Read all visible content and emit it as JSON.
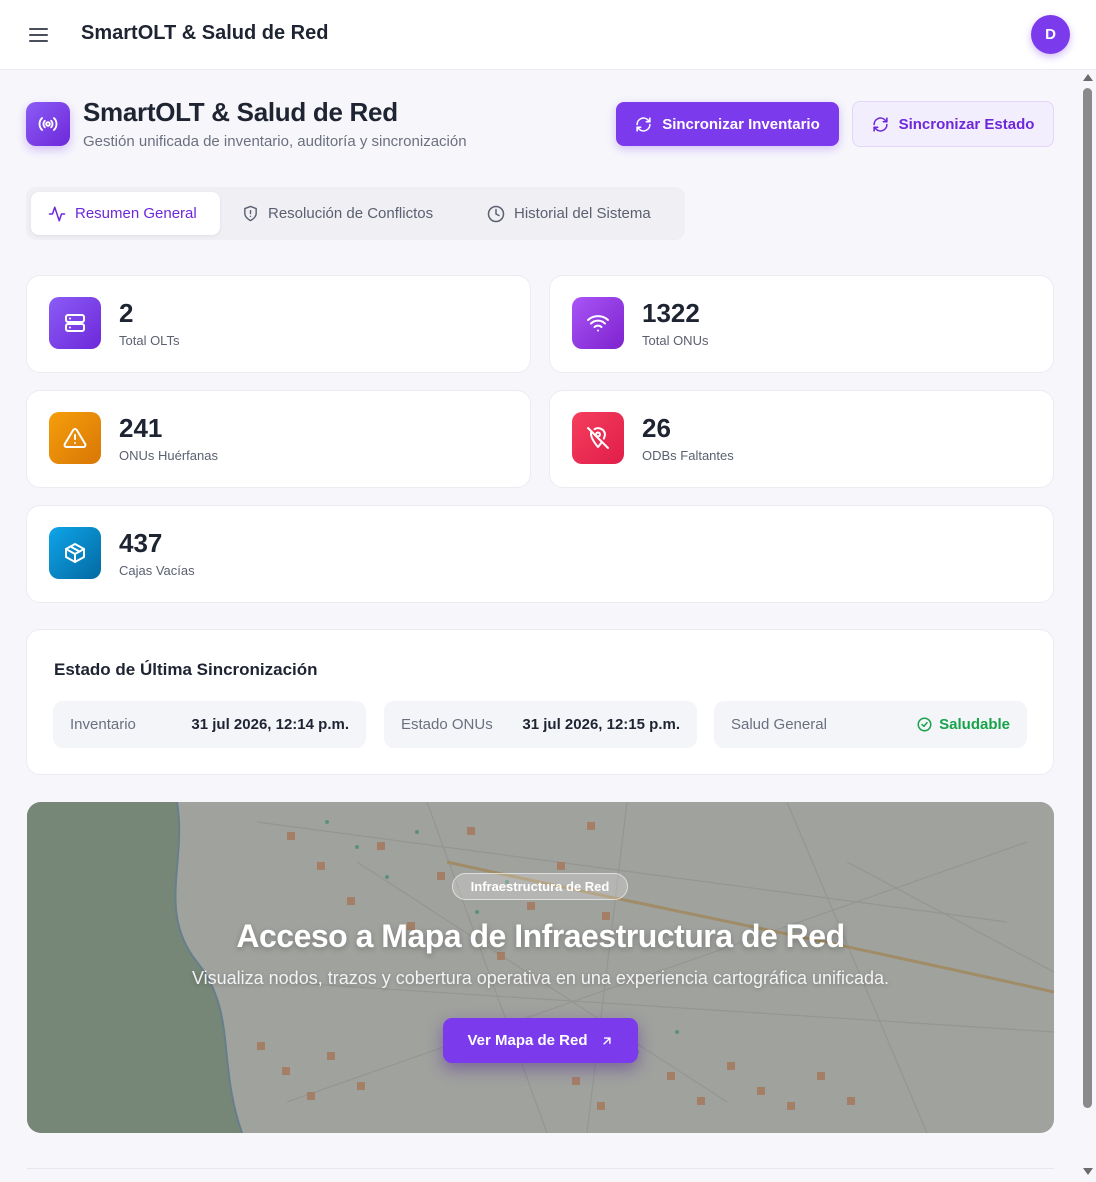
{
  "topbar": {
    "title": "SmartOLT & Salud de Red",
    "avatar_initial": "D"
  },
  "header": {
    "title": "SmartOLT & Salud de Red",
    "subtitle": "Gestión unificada de inventario, auditoría y sincronización",
    "icon": "broadcast-icon",
    "sync_inventory_label": "Sincronizar Inventario",
    "sync_status_label": "Sincronizar Estado"
  },
  "tabs": [
    {
      "label": "Resumen General",
      "icon": "activity-icon",
      "active": true
    },
    {
      "label": "Resolución de Conflictos",
      "icon": "shield-icon",
      "active": false
    },
    {
      "label": "Historial del Sistema",
      "icon": "clock-icon",
      "active": false
    }
  ],
  "stats": [
    {
      "value": "2",
      "label": "Total OLTs",
      "icon": "server-icon",
      "color": "#7c3aed"
    },
    {
      "value": "1322",
      "label": "Total ONUs",
      "icon": "wifi-icon",
      "color": "#9333ea"
    },
    {
      "value": "241",
      "label": "ONUs Huérfanas",
      "icon": "warning-icon",
      "color": "#f59e0b"
    },
    {
      "value": "26",
      "label": "ODBs Faltantes",
      "icon": "map-pin-off-icon",
      "color": "#e11d48"
    },
    {
      "value": "437",
      "label": "Cajas Vacías",
      "icon": "box-icon",
      "color": "#0284c7"
    }
  ],
  "sync": {
    "title": "Estado de Última Sincronización",
    "items": [
      {
        "label": "Inventario",
        "value": "31 jul 2026, 12:14 p.m."
      },
      {
        "label": "Estado ONUs",
        "value": "31 jul 2026, 12:15 p.m."
      },
      {
        "label": "Salud General",
        "value": "Saludable"
      }
    ]
  },
  "map_banner": {
    "chip": "Infraestructura de Red",
    "title": "Acceso a Mapa de Infraestructura de Red",
    "subtitle": "Visualiza nodos, trazos y cobertura operativa en una experiencia cartográfica unificada.",
    "button_label": "Ver Mapa de Red"
  },
  "colors": {
    "accent": "#7c3aed",
    "success": "#16a34a"
  }
}
